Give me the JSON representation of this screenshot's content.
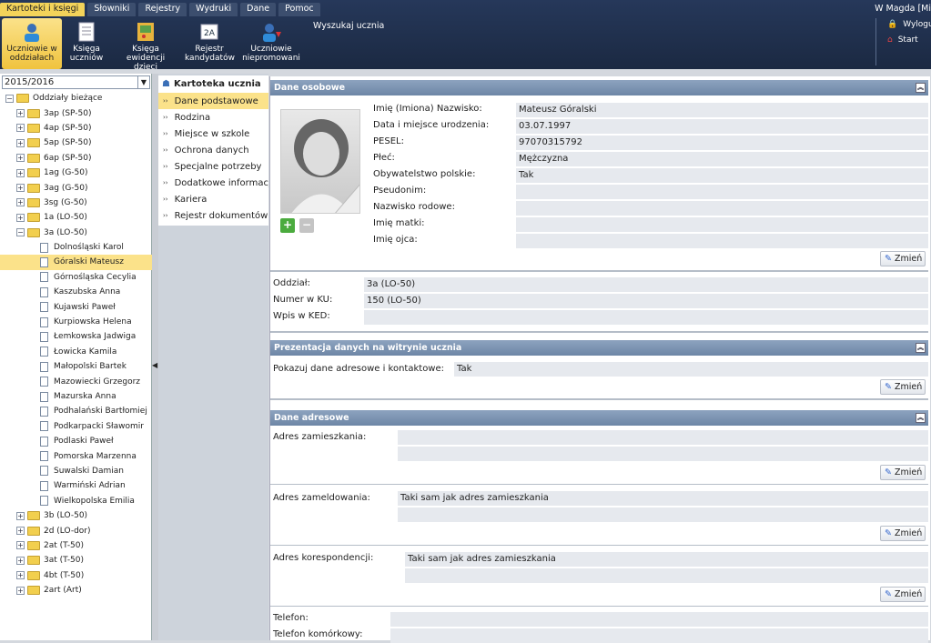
{
  "menubar": [
    "Kartoteki i księgi",
    "Słowniki",
    "Rejestry",
    "Wydruki",
    "Dane",
    "Pomoc"
  ],
  "user_label": "W Magda [Mi",
  "toolbar": [
    {
      "label": "Uczniowie w oddziałach",
      "icon": "student-icon"
    },
    {
      "label": "Księga uczniów",
      "icon": "book-icon"
    },
    {
      "label": "Księga ewidencji dzieci",
      "icon": "register-icon"
    },
    {
      "label": "Rejestr kandydatów",
      "icon": "candidates-icon"
    },
    {
      "label": "Uczniowie niepromowani",
      "icon": "student-down-icon"
    }
  ],
  "search_label": "Wyszukaj ucznia",
  "right_tools": {
    "logout": "Wylogu",
    "start": "Start"
  },
  "year": "2015/2016",
  "tree": {
    "root": "Oddziały bieżące",
    "classes_before": [
      "3ap (SP-50)",
      "4ap (SP-50)",
      "5ap (SP-50)",
      "6ap (SP-50)",
      "1ag (G-50)",
      "3ag (G-50)",
      "3sg (G-50)",
      "1a (LO-50)"
    ],
    "open_class": "3a (LO-50)",
    "students": [
      "Dolnośląski Karol",
      "Góralski Mateusz",
      "Górnośląska Cecylia",
      "Kaszubska Anna",
      "Kujawski Paweł",
      "Kurpiowska Helena",
      "Łemkowska Jadwiga",
      "Łowicka Kamila",
      "Małopolski Bartek",
      "Mazowiecki Grzegorz",
      "Mazurska Anna",
      "Podhalański Bartłomiej",
      "Podkarpacki Sławomir",
      "Podlaski Paweł",
      "Pomorska Marzenna",
      "Suwalski Damian",
      "Warmiński Adrian",
      "Wielkopolska Emilia"
    ],
    "selected_student": "Góralski Mateusz",
    "classes_after": [
      "3b (LO-50)",
      "2d (LO-dor)",
      "2at (T-50)",
      "3at (T-50)",
      "4bt (T-50)",
      "2art (Art)"
    ]
  },
  "nav": {
    "title": "Kartoteka ucznia",
    "items": [
      "Dane podstawowe",
      "Rodzina",
      "Miejsce w szkole",
      "Ochrona danych",
      "Specjalne potrzeby",
      "Dodatkowe informacje",
      "Kariera",
      "Rejestr dokumentów"
    ],
    "active": "Dane podstawowe"
  },
  "sections": {
    "dane_osobowe": "Dane osobowe",
    "prezentacja": "Prezentacja danych na witrynie ucznia",
    "adresowe": "Dane adresowe"
  },
  "personal": [
    {
      "label": "Imię (Imiona) Nazwisko:",
      "value": "Mateusz Góralski"
    },
    {
      "label": "Data i miejsce urodzenia:",
      "value": "03.07.1997"
    },
    {
      "label": "PESEL:",
      "value": "97070315792"
    },
    {
      "label": "Płeć:",
      "value": "Mężczyzna"
    },
    {
      "label": "Obywatelstwo polskie:",
      "value": "Tak"
    },
    {
      "label": "Pseudonim:",
      "value": ""
    },
    {
      "label": "Nazwisko rodowe:",
      "value": ""
    },
    {
      "label": "Imię matki:",
      "value": ""
    },
    {
      "label": "Imię ojca:",
      "value": ""
    }
  ],
  "school": [
    {
      "label": "Oddział:",
      "value": "3a (LO-50)"
    },
    {
      "label": "Numer w KU:",
      "value": "150 (LO-50)"
    },
    {
      "label": "Wpis w KED:",
      "value": ""
    }
  ],
  "presentation": {
    "label": "Pokazuj dane adresowe i kontaktowe:",
    "value": "Tak"
  },
  "address": {
    "zamieszkania": {
      "label": "Adres zamieszkania:",
      "value": ""
    },
    "zameldowania": {
      "label": "Adres zameldowania:",
      "value": "Taki sam jak adres zamieszkania"
    },
    "korespondencji": {
      "label": "Adres korespondencji:",
      "value": "Taki sam jak adres zamieszkania"
    }
  },
  "contact": [
    {
      "label": "Telefon:",
      "value": ""
    },
    {
      "label": "Telefon komórkowy:",
      "value": ""
    }
  ],
  "zmien_label": "Zmień",
  "colors": {
    "accent": "#f3d35a",
    "header": "#1b2942",
    "section": "#7790b0"
  }
}
